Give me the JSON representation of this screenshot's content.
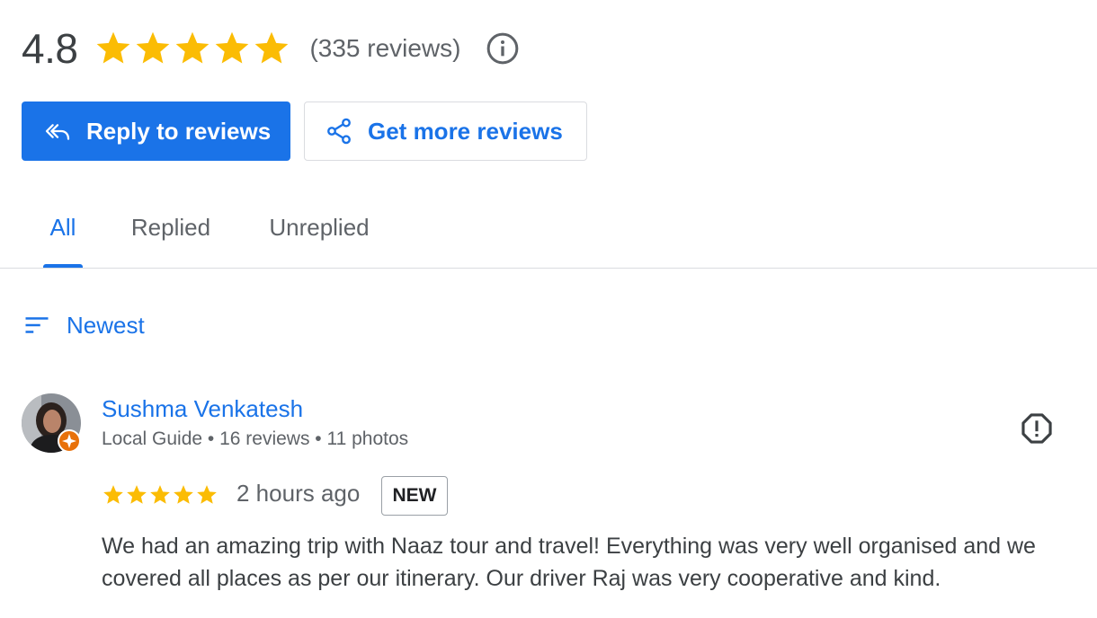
{
  "summary": {
    "score": "4.8",
    "stars": 5,
    "review_count": "(335 reviews)",
    "info_icon": "info-icon"
  },
  "actions": {
    "reply_label": "Reply to reviews",
    "reply_icon": "reply-all-icon",
    "get_more_label": "Get more reviews",
    "get_more_icon": "share-icon"
  },
  "tabs": [
    {
      "label": "All",
      "active": true
    },
    {
      "label": "Replied",
      "active": false
    },
    {
      "label": "Unreplied",
      "active": false
    }
  ],
  "sort": {
    "label": "Newest",
    "icon": "sort-icon"
  },
  "review": {
    "author": "Sushma Venkatesh",
    "meta": "Local Guide • 16 reviews • 11 photos",
    "rating": 5,
    "time": "2 hours ago",
    "badge": "NEW",
    "text": "We had an amazing trip with Naaz tour and travel! Everything was very well organised and we covered all places as per our itinerary. Our driver Raj was very cooperative and kind.",
    "flag_icon": "report-icon"
  },
  "colors": {
    "accent": "#1a73e8",
    "star": "#fbbc04",
    "guide_badge": "#e8710a",
    "divider": "#dadce0"
  }
}
